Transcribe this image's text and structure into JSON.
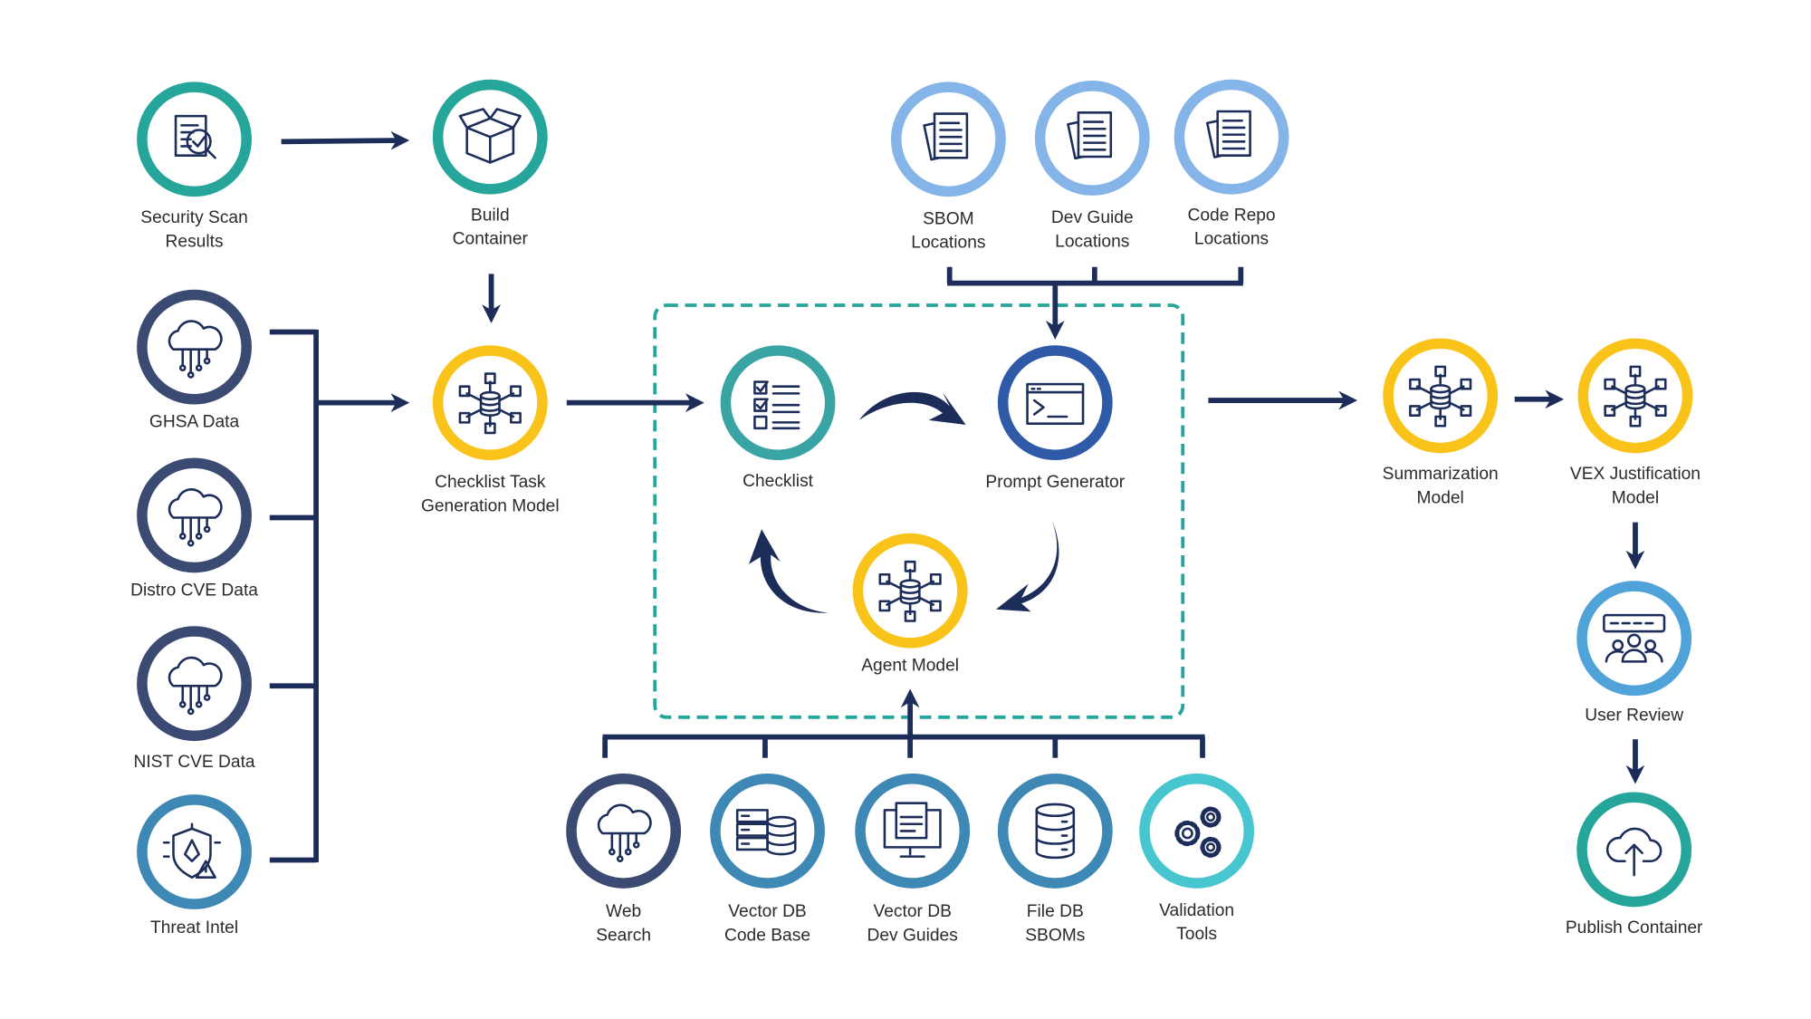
{
  "colors": {
    "arrow": "#1c2d5a",
    "teal": "#26a69a",
    "light_blue": "#84b4e8",
    "navy": "#3a4a72",
    "steel_blue": "#3e88b5",
    "yellow": "#f9c31a",
    "checklist_teal": "#3aa3a3",
    "prompt_blue": "#2f5aa8",
    "sky_blue": "#4fa3d8",
    "cyan": "#48c6cf",
    "dashed_box": "#26a69a"
  },
  "nodes": {
    "security_scan": {
      "lines": [
        "Security Scan",
        "Results"
      ],
      "icon": "document-search-icon",
      "color": "teal"
    },
    "build_container": {
      "lines": [
        "Build",
        "Container"
      ],
      "icon": "box-icon",
      "color": "teal"
    },
    "sbom_locations": {
      "lines": [
        "SBOM",
        "Locations"
      ],
      "icon": "documents-icon",
      "color": "light_blue"
    },
    "dev_guide_locations": {
      "lines": [
        "Dev Guide",
        "Locations"
      ],
      "icon": "documents-icon",
      "color": "light_blue"
    },
    "code_repo_locations": {
      "lines": [
        "Code Repo",
        "Locations"
      ],
      "icon": "documents-icon",
      "color": "light_blue"
    },
    "ghsa_data": {
      "lines": [
        "GHSA Data"
      ],
      "icon": "cloud-network-icon",
      "color": "navy"
    },
    "distro_cve_data": {
      "lines": [
        "Distro CVE Data"
      ],
      "icon": "cloud-network-icon",
      "color": "navy"
    },
    "nist_cve_data": {
      "lines": [
        "NIST CVE Data"
      ],
      "icon": "cloud-network-icon",
      "color": "navy"
    },
    "threat_intel": {
      "lines": [
        "Threat Intel"
      ],
      "icon": "shield-alert-icon",
      "color": "steel_blue"
    },
    "checklist_task_model": {
      "lines": [
        "Checklist Task",
        "Generation Model"
      ],
      "icon": "model-network-icon",
      "color": "yellow"
    },
    "checklist": {
      "lines": [
        "Checklist"
      ],
      "icon": "checklist-icon",
      "color": "checklist_teal"
    },
    "prompt_generator": {
      "lines": [
        "Prompt Generator"
      ],
      "icon": "terminal-icon",
      "color": "prompt_blue"
    },
    "agent_model": {
      "lines": [
        "Agent Model"
      ],
      "icon": "model-network-icon",
      "color": "yellow"
    },
    "summarization_model": {
      "lines": [
        "Summarization",
        "Model"
      ],
      "icon": "model-network-icon",
      "color": "yellow"
    },
    "vex_model": {
      "lines": [
        "VEX Justification",
        "Model"
      ],
      "icon": "model-network-icon",
      "color": "yellow"
    },
    "user_review": {
      "lines": [
        "User Review"
      ],
      "icon": "users-rating-icon",
      "color": "sky_blue"
    },
    "publish_container": {
      "lines": [
        "Publish Container"
      ],
      "icon": "cloud-upload-icon",
      "color": "teal"
    },
    "web_search": {
      "lines": [
        "Web",
        "Search"
      ],
      "icon": "cloud-network-icon",
      "color": "navy"
    },
    "vector_db_code": {
      "lines": [
        "Vector DB",
        "Code Base"
      ],
      "icon": "server-database-icon",
      "color": "steel_blue"
    },
    "vector_db_dev": {
      "lines": [
        "Vector DB",
        "Dev Guides"
      ],
      "icon": "monitor-code-icon",
      "color": "steel_blue"
    },
    "file_db_sboms": {
      "lines": [
        "File DB",
        "SBOMs"
      ],
      "icon": "database-icon",
      "color": "steel_blue"
    },
    "validation_tools": {
      "lines": [
        "Validation",
        "Tools"
      ],
      "icon": "gears-icon",
      "color": "cyan"
    }
  }
}
